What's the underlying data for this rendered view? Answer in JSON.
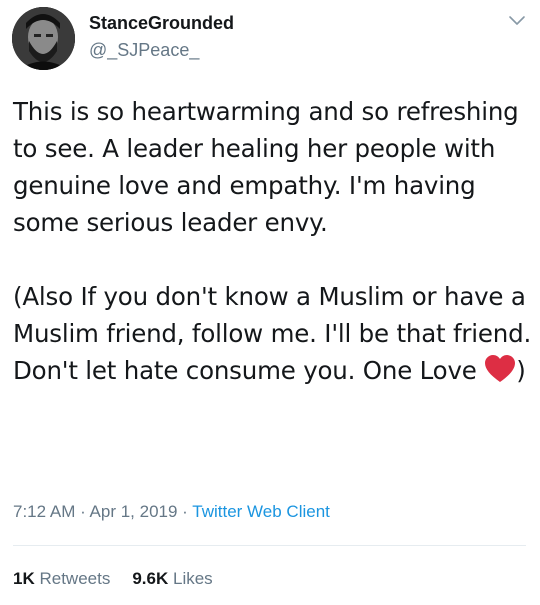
{
  "author": {
    "display_name": "StanceGrounded",
    "handle": "@_SJPeace_"
  },
  "tweet": {
    "paragraph_1": "This is so heartwarming and so refreshing to see. A leader healing her people with genuine love and empathy. I'm having some serious leader envy.",
    "paragraph_2_text": "(Also If you don't know a Muslim or have a Muslim friend, follow me. I'll be that friend. Don't let hate consume you. One Love ",
    "paragraph_2_emoji": "red-heart-emoji",
    "paragraph_2_end": ")"
  },
  "meta": {
    "time": "7:12 AM",
    "separator_1": " · ",
    "date": "Apr 1, 2019",
    "separator_2": " · ",
    "client": "Twitter Web Client"
  },
  "stats": {
    "retweets_count": "1K",
    "retweets_label": "Retweets",
    "likes_count": "9.6K",
    "likes_label": "Likes"
  },
  "icons": {
    "caret": "chevron-down-icon",
    "heart": "red-heart-emoji"
  },
  "colors": {
    "text": "#14171a",
    "secondary": "#657786",
    "link": "#1b95e0",
    "heart": "#e0245e",
    "divider": "#e6ecf0"
  }
}
